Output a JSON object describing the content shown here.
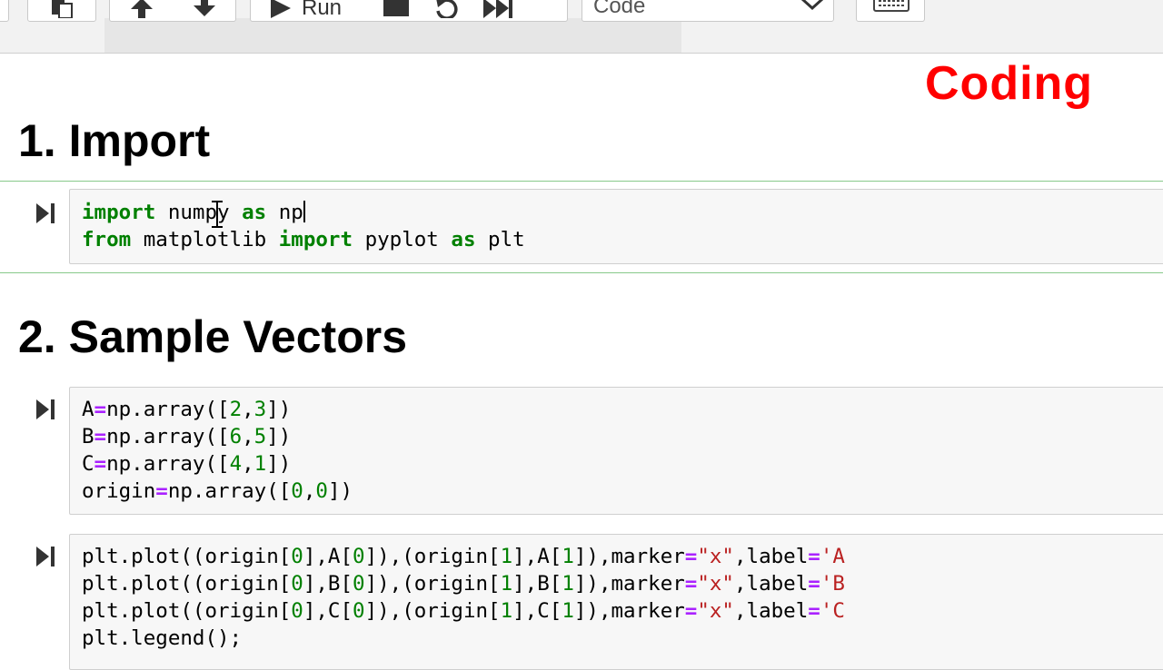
{
  "toolbar": {
    "run_label": "Run",
    "cell_type": "Code"
  },
  "badge": "Coding",
  "sections": {
    "import": {
      "title": "1. Import"
    },
    "vectors": {
      "title": "2. Sample Vectors"
    }
  },
  "cells": {
    "import": {
      "line1": [
        "import",
        " ",
        "numpy",
        " ",
        "as",
        " ",
        "np"
      ],
      "line2": [
        "from",
        " matplotlib ",
        "import",
        " pyplot ",
        "as",
        " plt"
      ]
    },
    "vectors": {
      "lines": [
        "A=np.array([2,3])",
        "B=np.array([6,5])",
        "C=np.array([4,1])",
        "origin=np.array([0,0])"
      ]
    },
    "plot": {
      "lines": [
        "plt.plot((origin[0],A[0]),(origin[1],A[1]),marker=\"x\",label='A",
        "plt.plot((origin[0],B[0]),(origin[1],B[1]),marker=\"x\",label='B",
        "plt.plot((origin[0],C[0]),(origin[1],C[1]),marker=\"x\",label='C",
        "plt.legend();"
      ]
    }
  },
  "colors": {
    "keyword": "#008000",
    "operator": "#aa22ff",
    "string": "#ba2121",
    "badge": "#ff0000",
    "selected_rule": "#88c98a"
  }
}
